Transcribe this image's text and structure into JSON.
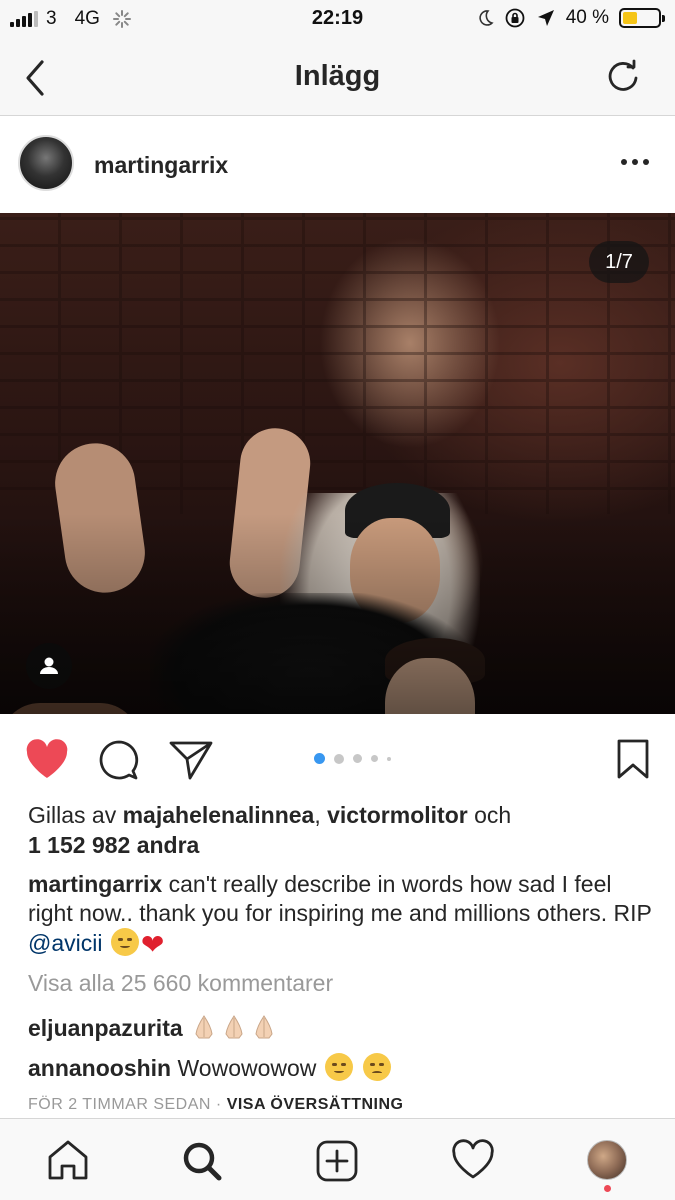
{
  "status_bar": {
    "carrier": "3",
    "network": "4G",
    "time": "22:19",
    "battery": "40 %",
    "battery_level": 0.4
  },
  "header": {
    "title": "Inlägg"
  },
  "post": {
    "username": "martingarrix",
    "photo_counter": "1/7",
    "carousel_index": 1,
    "carousel_total": 7,
    "likes": {
      "prefix": "Gillas av",
      "user1": "majahelenalinnea",
      "separator": ",",
      "user2": "victormolitor",
      "conjunction": "och",
      "others": "1 152 982 andra"
    },
    "caption": {
      "username": "martingarrix",
      "text": "can't really describe in words how sad I feel right now.. thank you for inspiring me and millions others. RIP",
      "mention": "@avicii"
    },
    "view_all_comments": "Visa alla 25 660 kommentarer",
    "comments": [
      {
        "username": "eljuanpazurita",
        "text": ""
      },
      {
        "username": "annanooshin",
        "text": "Wowowowow"
      }
    ],
    "timestamp": "FÖR 2 TIMMAR SEDAN",
    "separator": "·",
    "translate": "VISA ÖVERSÄTTNING"
  },
  "colors": {
    "like_red": "#ed4956",
    "link_blue": "#003569",
    "muted": "#999999",
    "carousel_active": "#3897f0"
  },
  "icons": {
    "back": "chevron-left-icon",
    "refresh": "refresh-icon",
    "more": "more-horizontal-icon",
    "like": "heart-filled-icon",
    "comment": "comment-icon",
    "share": "paper-plane-icon",
    "save": "bookmark-icon",
    "tag": "person-tag-icon",
    "home": "home-icon",
    "search": "search-icon",
    "new_post": "plus-square-icon",
    "activity": "heart-outline-icon",
    "profile": "profile-avatar"
  }
}
